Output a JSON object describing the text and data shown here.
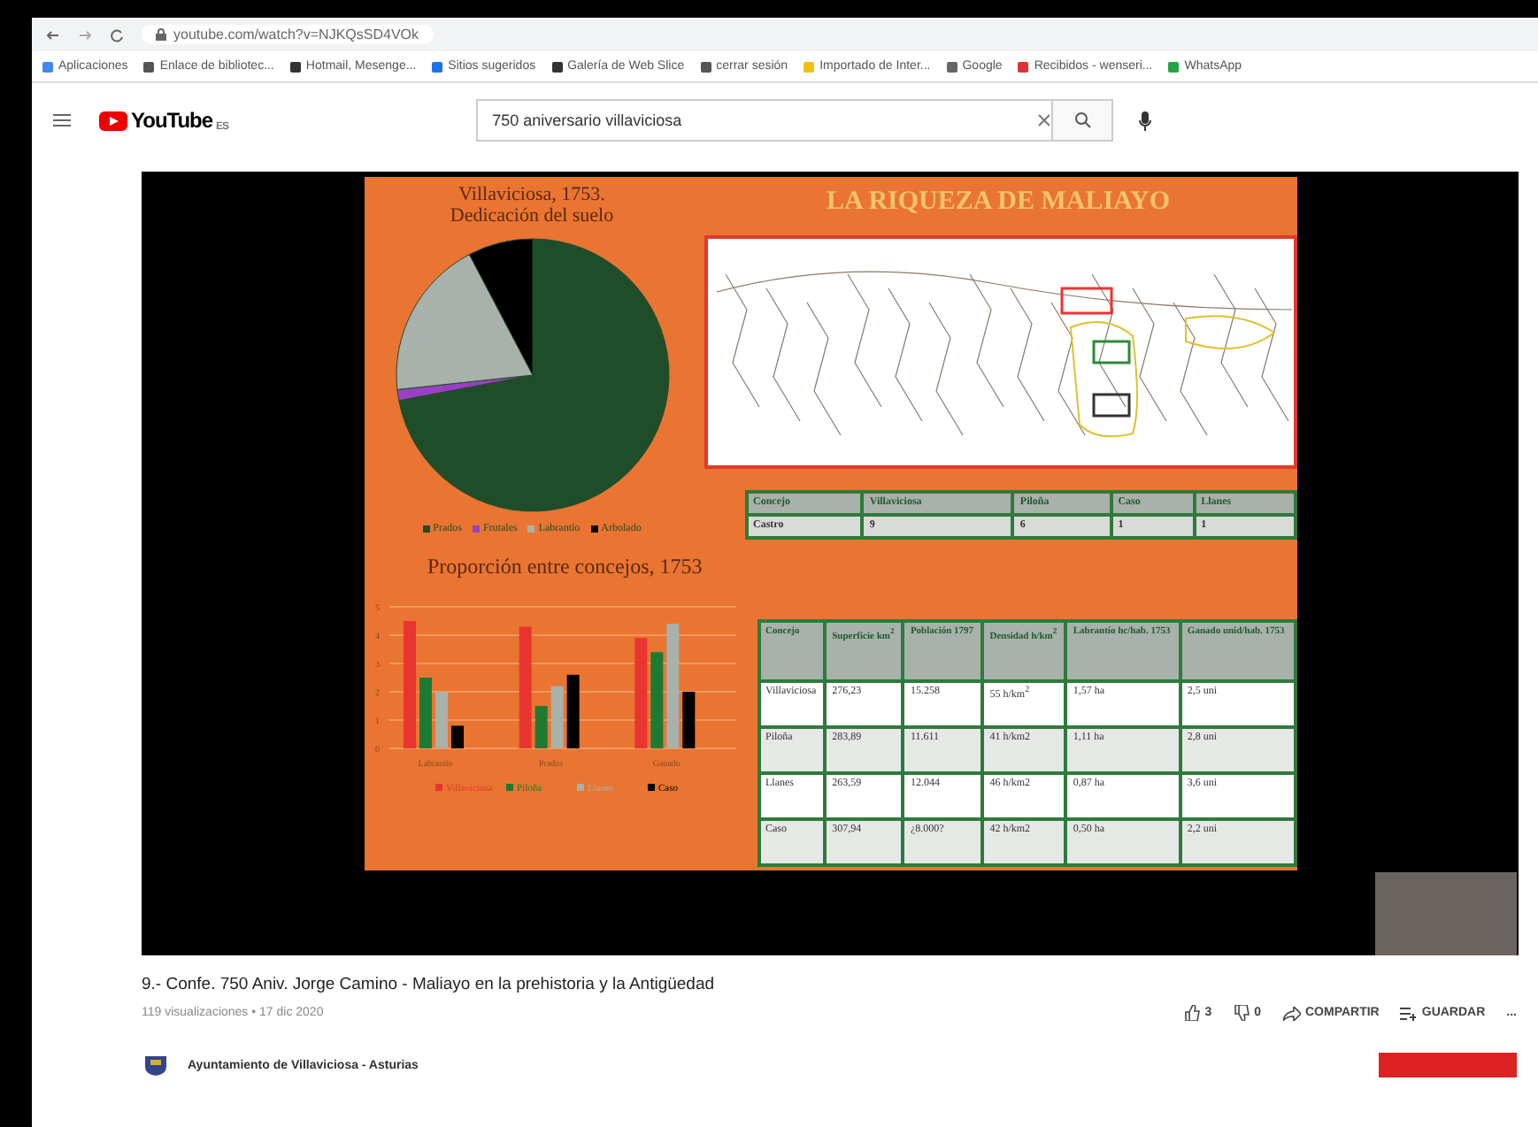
{
  "browser": {
    "url": "youtube.com/watch?v=NJKQsSD4VOk",
    "bookmarks": [
      "Aplicaciones",
      "Enlace de bibliotec...",
      "Hotmail, Mesenge...",
      "Sitios sugeridos",
      "Galería de Web Slice",
      "cerrar sesión",
      "Importado de Inter...",
      "Google",
      "Recibidos - wenseri...",
      "WhatsApp"
    ]
  },
  "header": {
    "logo": "YouTube",
    "region": "ES",
    "search": {
      "value": "750 aniversario villaviciosa"
    }
  },
  "slide": {
    "title": "LA RIQUEZA DE MALIAYO",
    "pie": {
      "title": "Villaviciosa, 1753. Dedicación del suelo",
      "legend": [
        {
          "label": "Prados",
          "color": "#1f4d2a"
        },
        {
          "label": "Frutales",
          "color": "#9b3fc4"
        },
        {
          "label": "Labrantío",
          "color": "#a9b1ab"
        },
        {
          "label": "Arbolado",
          "color": "#000000"
        }
      ]
    },
    "table_1": {
      "columns": [
        "Concejo",
        "Villaviciosa",
        "Piloña",
        "Caso",
        "Llanes"
      ],
      "rows": [
        [
          "Castro",
          "9",
          "6",
          "1",
          "1"
        ]
      ]
    },
    "bar_title": "Proporción entre concejos, 1753",
    "chart_data": {
      "type": "bar",
      "grid": true,
      "legend": true,
      "categories": [
        "Labrantío",
        "Prados",
        "Ganado"
      ],
      "ylim": [
        0,
        5
      ],
      "yticks": [
        0,
        1,
        2,
        3,
        4,
        5
      ],
      "series": [
        {
          "name": "Villaviciosa",
          "color": "#e8352f",
          "values": [
            4.5,
            4.3,
            3.9
          ]
        },
        {
          "name": "Piloña",
          "color": "#1e7a32",
          "values": [
            2.5,
            1.5,
            3.4
          ]
        },
        {
          "name": "Llanes",
          "color": "#a9b1ab",
          "values": [
            2.0,
            2.2,
            4.4
          ]
        },
        {
          "name": "Caso",
          "color": "#000000",
          "values": [
            0.8,
            2.6,
            2.0
          ]
        }
      ]
    },
    "table_2": {
      "columns": [
        "Concejo",
        "Superficie km$^{2}$",
        "Población 1797",
        "Densidad h/km$^{2}$",
        "Labrantío hc/hab. 1753",
        "Ganado unid/hab. 1753"
      ],
      "rows": [
        [
          "Villaviciosa",
          "276,23",
          "15.258",
          "55 h/km$^{2}$",
          "1,57 ha",
          "2,5 uni"
        ],
        [
          "Piloña",
          "283,89",
          "11.611",
          "41 h/km2",
          "1,11 ha",
          "2,8 uni"
        ],
        [
          "Llanes",
          "263,59",
          "12.044",
          "46 h/km2",
          "0,87 ha",
          "3,6 uni"
        ],
        [
          "Caso",
          "307,94",
          "¿8.000?",
          "42 h/km2",
          "0,50 ha",
          "2,2 uni"
        ]
      ]
    }
  },
  "video": {
    "title": "9.- Confe. 750 Aniv. Jorge Camino - Maliayo en la prehistoria y la Antigüedad",
    "meta": "119 visualizaciones • 17 dic 2020",
    "likes": "3",
    "dislikes": "0",
    "share": "COMPARTIR",
    "save": "GUARDAR",
    "more": "..."
  },
  "channel": {
    "name": "Ayuntamiento de Villaviciosa - Asturias"
  }
}
